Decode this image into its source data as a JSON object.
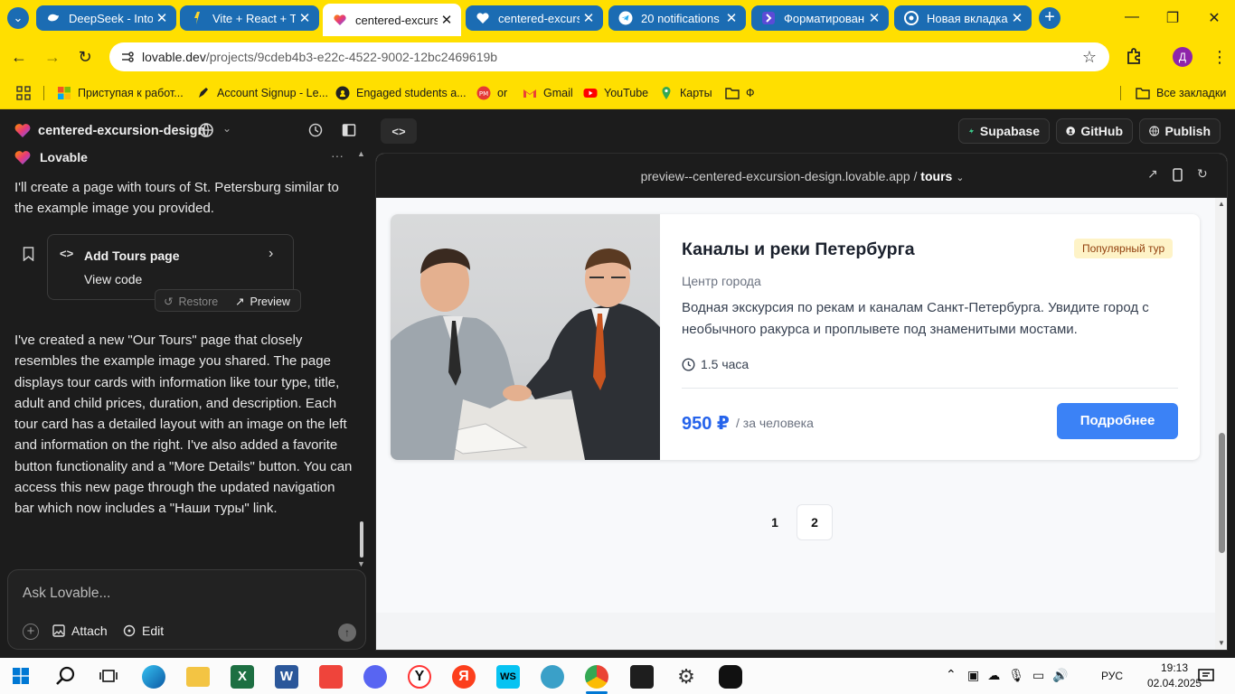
{
  "browser": {
    "tabs": [
      {
        "title": "DeepSeek - Into",
        "icon": "deepseek-icon"
      },
      {
        "title": "Vite + React + T",
        "icon": "vite-icon"
      },
      {
        "title": "centered-excursi",
        "icon": "lovable-icon",
        "active": true
      },
      {
        "title": "centered-excursi",
        "icon": "heart-icon"
      },
      {
        "title": "20 notifications",
        "icon": "telegram-icon"
      },
      {
        "title": "Форматировани",
        "icon": "forms-icon"
      },
      {
        "title": "Новая вкладка",
        "icon": "chrome-icon"
      }
    ],
    "url_host": "lovable.dev",
    "url_path": "/projects/9cdeb4b3-e22c-4522-9002-12bc2469619b",
    "profile_initial": "Д",
    "bookmarks": [
      {
        "label": "Приступая к работ...",
        "icon": "windows-icon"
      },
      {
        "label": "Account Signup - Le...",
        "icon": "pen-icon"
      },
      {
        "label": "Engaged students a...",
        "icon": "github-icon"
      },
      {
        "label": "or",
        "icon": "pm-icon"
      },
      {
        "label": "Gmail",
        "icon": "gmail-icon"
      },
      {
        "label": "YouTube",
        "icon": "youtube-icon"
      },
      {
        "label": "Карты",
        "icon": "maps-icon"
      },
      {
        "label": "Ф",
        "icon": "folder-icon"
      }
    ],
    "all_bookmarks": "Все закладки"
  },
  "app": {
    "project_title": "centered-excursion-design",
    "supabase": "Supabase",
    "github": "GitHub",
    "publish": "Publish"
  },
  "chat": {
    "author": "Lovable",
    "intro": "I'll create a page with tours of St. Petersburg similar to the example image you provided.",
    "card_title": "Add Tours page",
    "card_link": "View code",
    "restore": "Restore",
    "preview": "Preview",
    "message": "I've created a new \"Our Tours\" page that closely resembles the example image you shared. The page displays tour cards with information like tour type, title, adult and child prices, duration, and description. Each tour card has a detailed layout with an image on the left and information on the right. I've also added a favorite button functionality and a \"More Details\" button. You can access this new page through the updated navigation bar which now includes a \"Наши туры\" link.",
    "input_placeholder": "Ask Lovable...",
    "attach": "Attach",
    "edit": "Edit"
  },
  "preview": {
    "address": "preview--centered-excursion-design.lovable.app",
    "route_sep": "/",
    "route": "tours",
    "tour": {
      "title": "Каналы и реки Петербурга",
      "badge": "Популярный тур",
      "location": "Центр города",
      "description": "Водная экскурсия по рекам и каналам Санкт-Петербурга. Увидите город с необычного ракурса и проплывете под знаменитыми мостами.",
      "duration": "1.5 часа",
      "price": "950 ₽",
      "price_unit": "/ за человека",
      "button": "Подробнее"
    },
    "pages": [
      "1",
      "2"
    ]
  },
  "taskbar": {
    "time": "19:13",
    "date": "02.04.2025",
    "lang": "РУС"
  },
  "colors": {
    "browser_chrome": "#ffdf00",
    "tab_inactive": "#1b6cb3",
    "accent_blue": "#3b82f6",
    "price_blue": "#2563eb",
    "badge_bg": "#fef3c7"
  }
}
